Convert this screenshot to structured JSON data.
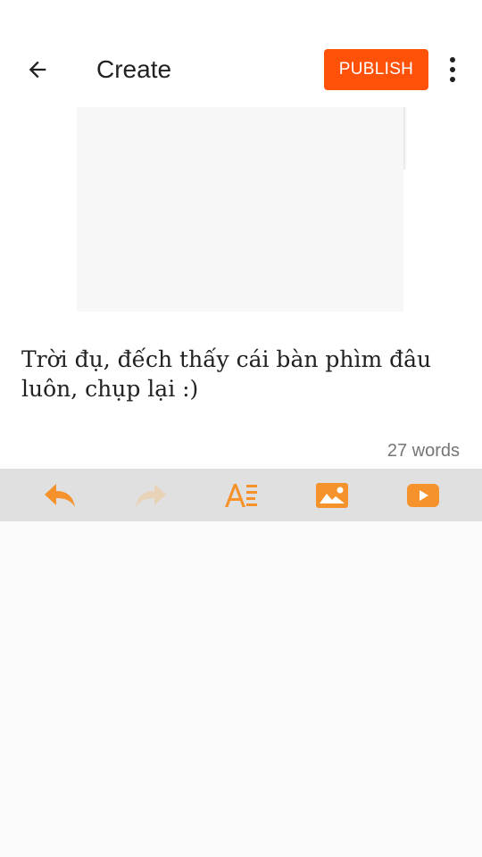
{
  "app_bar": {
    "title": "Create",
    "publish_label": "PUBLISH"
  },
  "editor": {
    "body_text": "Trời đụ, đếch thấy cái bàn phìm đâu luôn, chụp lại :)",
    "word_count": "27 words"
  },
  "toolbar": {
    "icons": [
      "undo-icon",
      "redo-icon",
      "text-format-icon",
      "image-icon",
      "video-icon"
    ]
  },
  "colors": {
    "accent": "#ff5108",
    "toolbar_icon": "#f5922b",
    "toolbar_icon_disabled": "#e8d3b8",
    "toolbar_bg": "#e0e0e0"
  }
}
